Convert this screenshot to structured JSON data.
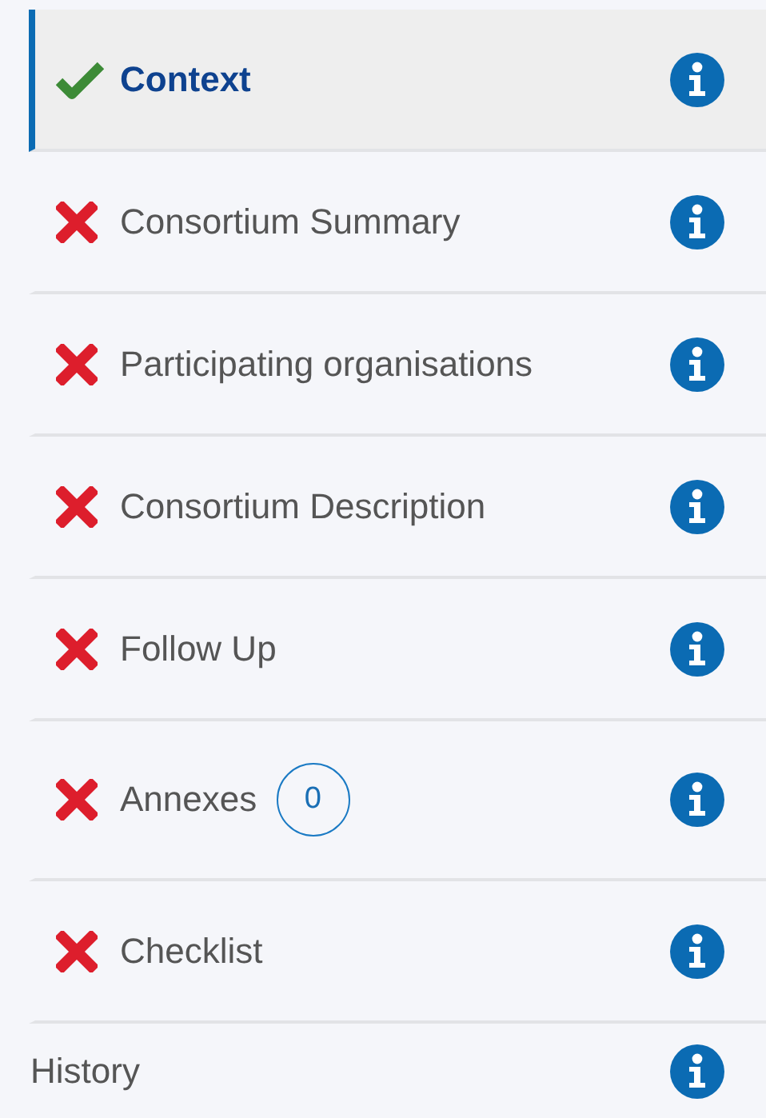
{
  "sections": [
    {
      "label": "Context",
      "kind": "complete",
      "selected": true
    },
    {
      "label": "Consortium Summary",
      "kind": "incomplete",
      "selected": false
    },
    {
      "label": "Participating organisations",
      "kind": "incomplete",
      "selected": false
    },
    {
      "label": "Consortium Description",
      "kind": "incomplete",
      "selected": false
    },
    {
      "label": "Follow Up",
      "kind": "incomplete",
      "selected": false
    },
    {
      "label": "Annexes",
      "kind": "incomplete",
      "selected": false,
      "badge": "0"
    },
    {
      "label": "Checklist",
      "kind": "incomplete",
      "selected": false
    },
    {
      "label": "History",
      "kind": "plain",
      "selected": false
    }
  ]
}
